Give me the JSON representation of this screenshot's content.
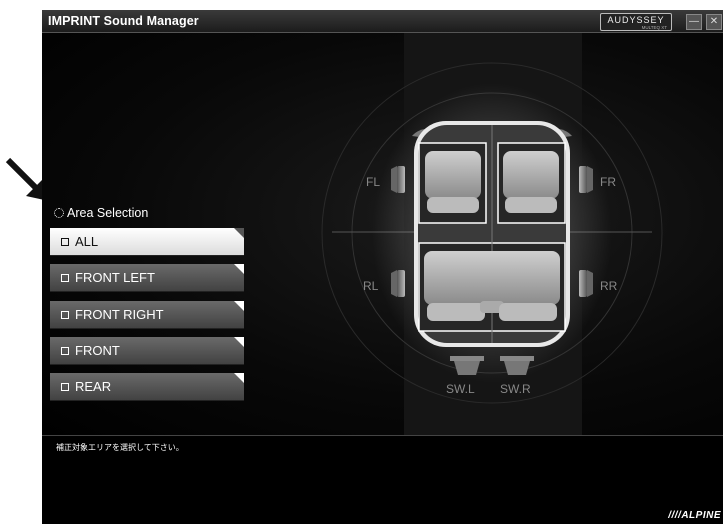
{
  "window": {
    "title": "IMPRINT Sound Manager",
    "brand_badge": "AUDYSSEY",
    "brand_badge_sub": "MULTEQ XT",
    "minimize_symbol": "—",
    "close_symbol": "✕"
  },
  "area_selection": {
    "heading": "Area Selection",
    "selected": "ALL",
    "options": [
      {
        "label": "ALL"
      },
      {
        "label": "FRONT LEFT"
      },
      {
        "label": "FRONT RIGHT"
      },
      {
        "label": "FRONT"
      },
      {
        "label": "REAR"
      }
    ]
  },
  "speakers": {
    "fl": "FL",
    "fr": "FR",
    "rl": "RL",
    "rr": "RR",
    "swl": "SW.L",
    "swr": "SW.R"
  },
  "status_message": "補正対象エリアを選択して下さい。",
  "footer_logo": "////ALPINE",
  "colors": {
    "background": "#000000",
    "selected_button": "#ffffff",
    "button": "#555555",
    "text": "#ffffff"
  },
  "icons": [
    "pointer-arrow-icon",
    "gear-icon",
    "checkbox-icon",
    "minimize-icon",
    "close-icon"
  ]
}
